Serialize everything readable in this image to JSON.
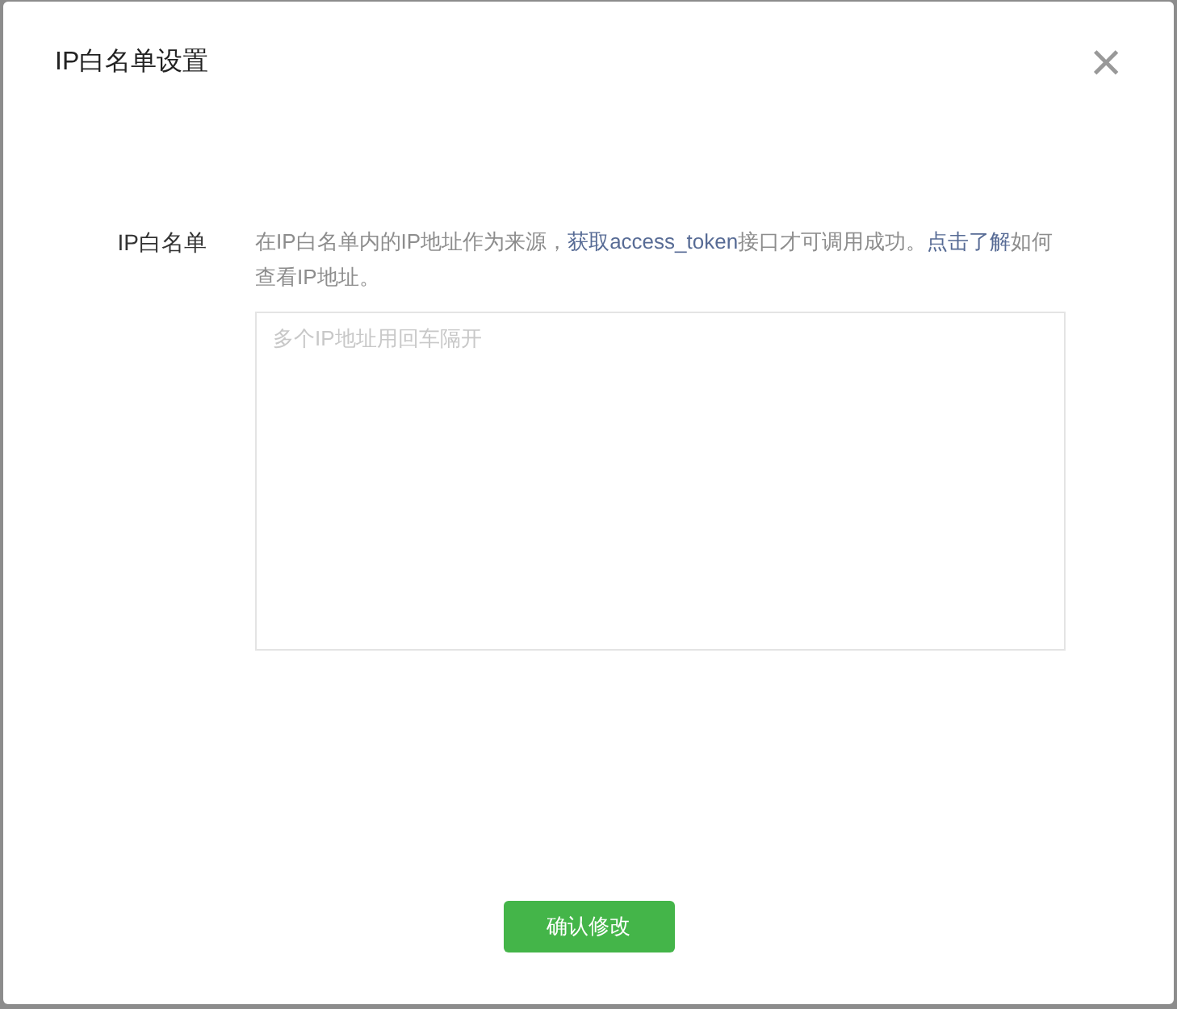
{
  "dialog": {
    "title": "IP白名单设置",
    "close_label": "×"
  },
  "field": {
    "label": "IP白名单",
    "description": [
      {
        "kind": "text",
        "text": "在IP白名单内的IP地址作为来源，"
      },
      {
        "kind": "link",
        "text": "获取access_token"
      },
      {
        "kind": "text",
        "text": "接口才可调用成功。"
      },
      {
        "kind": "link",
        "text": "点击了解"
      },
      {
        "kind": "text",
        "text": "如何查看IP地址。"
      }
    ],
    "placeholder": "多个IP地址用回车隔开"
  },
  "confirm_button": "确认修改"
}
